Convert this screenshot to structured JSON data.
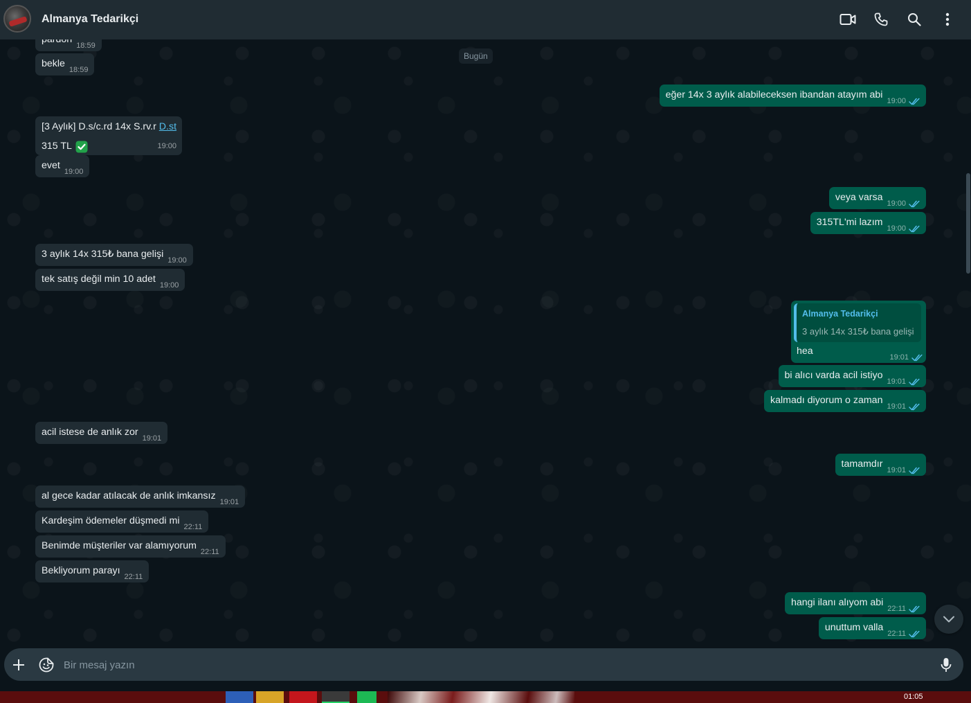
{
  "header": {
    "contact_name": "Almanya Tedarikçi"
  },
  "date_chip": "Bugün",
  "messages": {
    "m0": {
      "text": "pardon",
      "time": "18:59"
    },
    "m1": {
      "text": "bekle",
      "time": "18:59"
    },
    "m2": {
      "line1": "[3 Aylık] D.s/c.rd 14x S.rv.r ",
      "link": "D.st",
      "line2": "315 TL",
      "time": "19:00"
    },
    "m3": {
      "text": "evet",
      "time": "19:00"
    },
    "o1": {
      "text": "eğer 14x 3 aylık alabileceksen ibandan atayım abi",
      "time": "19:00"
    },
    "o2": {
      "text": "veya varsa",
      "time": "19:00"
    },
    "o3": {
      "text": "315TL'mi lazım",
      "time": "19:00"
    },
    "m4": {
      "text": "3 aylık 14x 315₺ bana gelişi",
      "time": "19:00"
    },
    "m5": {
      "text": "tek satış değil min 10 adet",
      "time": "19:00"
    },
    "o4": {
      "quote_name": "Almanya Tedarikçi",
      "quote_text": "3 aylık 14x 315₺ bana gelişi",
      "text": "hea",
      "time": "19:01"
    },
    "o5": {
      "text": "bi alıcı varda acil istiyo",
      "time": "19:01"
    },
    "o6": {
      "text": "kalmadı diyorum o zaman",
      "time": "19:01"
    },
    "m6": {
      "text": "acil istese de anlık zor",
      "time": "19:01"
    },
    "o7": {
      "text": "tamamdır",
      "time": "19:01"
    },
    "m7": {
      "text": "al gece kadar atılacak de anlık imkansız",
      "time": "19:01"
    },
    "m8": {
      "text": "Kardeşim ödemeler düşmedi mi",
      "time": "22:11"
    },
    "m9": {
      "text": "Benimde müşteriler var alamıyorum",
      "time": "22:11"
    },
    "m10": {
      "text": "Bekliyorum parayı",
      "time": "22:11"
    },
    "o8": {
      "text": "hangi ilanı alıyom abi",
      "time": "22:11"
    },
    "o9": {
      "text": "unuttum valla",
      "time": "22:11"
    }
  },
  "composer": {
    "placeholder": "Bir mesaj yazın"
  },
  "taskbar": {
    "clock": "01:05"
  },
  "colors": {
    "header_bg": "#202c33",
    "chat_bg": "#0b141a",
    "incoming_bubble": "#202c33",
    "outgoing_bubble": "#005c4b",
    "read_tick": "#53bdeb",
    "link": "#53bdeb"
  },
  "icons": {
    "header": [
      "video-call-icon",
      "phone-icon",
      "search-icon",
      "menu-dots-icon"
    ],
    "composer": [
      "plus-icon",
      "sticker-icon",
      "microphone-icon"
    ]
  }
}
